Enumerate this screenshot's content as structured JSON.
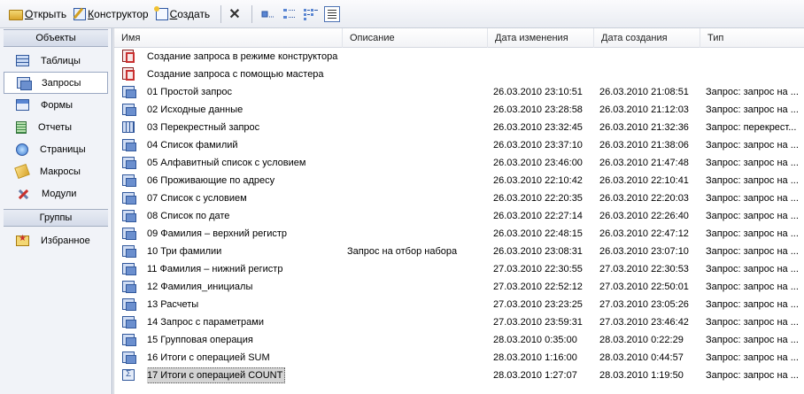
{
  "toolbar": {
    "open_label": "Открыть",
    "design_label": "Конструктор",
    "create_label": "Создать",
    "delete_symbol": "✕"
  },
  "nav": {
    "objects_header": "Объекты",
    "items": [
      {
        "label": "Таблицы",
        "icon": "table-icon"
      },
      {
        "label": "Запросы",
        "icon": "query-icon"
      },
      {
        "label": "Формы",
        "icon": "form-icon"
      },
      {
        "label": "Отчеты",
        "icon": "report-icon"
      },
      {
        "label": "Страницы",
        "icon": "page-icon"
      },
      {
        "label": "Макросы",
        "icon": "macro-icon"
      },
      {
        "label": "Модули",
        "icon": "module-icon"
      }
    ],
    "groups_header": "Группы",
    "favorites_label": "Избранное"
  },
  "columns": {
    "name": "Имя",
    "description": "Описание",
    "modified": "Дата изменения",
    "created": "Дата создания",
    "type": "Тип"
  },
  "rows": [
    {
      "icon": "wizard",
      "name": "Создание запроса в режиме конструктора",
      "description": "",
      "modified": "",
      "created": "",
      "type": ""
    },
    {
      "icon": "wizard",
      "name": "Создание запроса с помощью мастера",
      "description": "",
      "modified": "",
      "created": "",
      "type": ""
    },
    {
      "icon": "query",
      "name": "01 Простой запрос",
      "description": "",
      "modified": "26.03.2010 23:10:51",
      "created": "26.03.2010 21:08:51",
      "type": "Запрос: запрос на ..."
    },
    {
      "icon": "query",
      "name": "02 Исходные данные",
      "description": "",
      "modified": "26.03.2010 23:28:58",
      "created": "26.03.2010 21:12:03",
      "type": "Запрос: запрос на ..."
    },
    {
      "icon": "cross",
      "name": "03 Перекрестный запрос",
      "description": "",
      "modified": "26.03.2010 23:32:45",
      "created": "26.03.2010 21:32:36",
      "type": "Запрос: перекрест..."
    },
    {
      "icon": "query",
      "name": "04 Список фамилий",
      "description": "",
      "modified": "26.03.2010 23:37:10",
      "created": "26.03.2010 21:38:06",
      "type": "Запрос: запрос на ..."
    },
    {
      "icon": "query",
      "name": "05 Алфавитный список с условием",
      "description": "",
      "modified": "26.03.2010 23:46:00",
      "created": "26.03.2010 21:47:48",
      "type": "Запрос: запрос на ..."
    },
    {
      "icon": "query",
      "name": "06 Проживающие по адресу",
      "description": "",
      "modified": "26.03.2010 22:10:42",
      "created": "26.03.2010 22:10:41",
      "type": "Запрос: запрос на ..."
    },
    {
      "icon": "query",
      "name": "07 Список с условием",
      "description": "",
      "modified": "26.03.2010 22:20:35",
      "created": "26.03.2010 22:20:03",
      "type": "Запрос: запрос на ..."
    },
    {
      "icon": "query",
      "name": "08 Список по дате",
      "description": "",
      "modified": "26.03.2010 22:27:14",
      "created": "26.03.2010 22:26:40",
      "type": "Запрос: запрос на ..."
    },
    {
      "icon": "query",
      "name": "09 Фамилия – верхний регистр",
      "description": "",
      "modified": "26.03.2010 22:48:15",
      "created": "26.03.2010 22:47:12",
      "type": "Запрос: запрос на ..."
    },
    {
      "icon": "query",
      "name": "10 Три фамилии",
      "description": "Запрос на отбор набора",
      "modified": "26.03.2010 23:08:31",
      "created": "26.03.2010 23:07:10",
      "type": "Запрос: запрос на ..."
    },
    {
      "icon": "query",
      "name": "11 Фамилия – нижний регистр",
      "description": "",
      "modified": "27.03.2010 22:30:55",
      "created": "27.03.2010 22:30:53",
      "type": "Запрос: запрос на ..."
    },
    {
      "icon": "query",
      "name": "12 Фамилия_инициалы",
      "description": "",
      "modified": "27.03.2010 22:52:12",
      "created": "27.03.2010 22:50:01",
      "type": "Запрос: запрос на ..."
    },
    {
      "icon": "query",
      "name": "13 Расчеты",
      "description": "",
      "modified": "27.03.2010 23:23:25",
      "created": "27.03.2010 23:05:26",
      "type": "Запрос: запрос на ..."
    },
    {
      "icon": "query",
      "name": "14 Запрос с параметрами",
      "description": "",
      "modified": "27.03.2010 23:59:31",
      "created": "27.03.2010 23:46:42",
      "type": "Запрос: запрос на ..."
    },
    {
      "icon": "query",
      "name": "15 Групповая операция",
      "description": "",
      "modified": "28.03.2010 0:35:00",
      "created": "28.03.2010 0:22:29",
      "type": "Запрос: запрос на ..."
    },
    {
      "icon": "query",
      "name": "16 Итоги с операцией SUM",
      "description": "",
      "modified": "28.03.2010 1:16:00",
      "created": "28.03.2010 0:44:57",
      "type": "Запрос: запрос на ..."
    },
    {
      "icon": "total",
      "name": "17 Итоги с операцией COUNT",
      "description": "",
      "modified": "28.03.2010 1:27:07",
      "created": "28.03.2010 1:19:50",
      "type": "Запрос: запрос на ...",
      "selected": true
    }
  ]
}
